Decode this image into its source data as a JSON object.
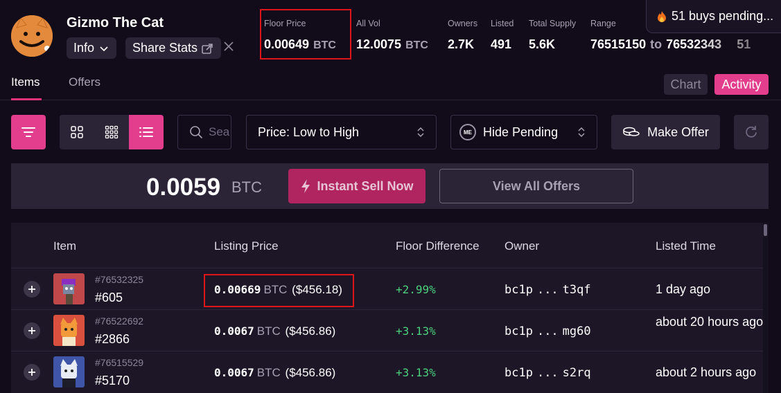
{
  "collection": {
    "name": "Gizmo The Cat",
    "info_label": "Info",
    "share_label": "Share Stats"
  },
  "stats": {
    "floor_label": "Floor Price",
    "floor_value": "0.00649",
    "floor_unit": "BTC",
    "vol_label": "All Vol",
    "vol_value": "12.0075",
    "vol_unit": "BTC",
    "owners_label": "Owners",
    "owners_value": "2.7K",
    "listed_label": "Listed",
    "listed_value": "491",
    "supply_label": "Total Supply",
    "supply_value": "5.6K",
    "range_label": "Range",
    "range_from": "76515150",
    "range_to_word": "to",
    "range_to": "76532343",
    "range_extra": "51"
  },
  "pending": {
    "text": "51 buys pending..."
  },
  "tabs": {
    "items": "Items",
    "offers": "Offers"
  },
  "view_toggle": {
    "chart": "Chart",
    "activity": "Activity"
  },
  "toolbar": {
    "search_placeholder": "Search",
    "sort_value": "Price: Low to High",
    "pending_value": "Hide Pending",
    "me_logo": "ME",
    "make_offer": "Make Offer"
  },
  "sell_banner": {
    "amount": "0.0059",
    "unit": "BTC",
    "instant_sell": "Instant Sell Now",
    "view_offers": "View All Offers"
  },
  "table": {
    "headers": {
      "item": "Item",
      "price": "Listing Price",
      "floor_diff": "Floor Difference",
      "owner": "Owner",
      "listed": "Listed Time"
    },
    "rows": [
      {
        "inscription": "#76532325",
        "name": "#605",
        "price": "0.00669",
        "unit": "BTC",
        "usd": "($456.18)",
        "floor_diff": "+2.99%",
        "owner_start": "bc1p",
        "owner_dots": "...",
        "owner_end": "t3qf",
        "listed": "1 day ago",
        "thumb_color": "#c0484a"
      },
      {
        "inscription": "#76522692",
        "name": "#2866",
        "price": "0.0067",
        "unit": "BTC",
        "usd": "($456.86)",
        "floor_diff": "+3.13%",
        "owner_start": "bc1p",
        "owner_dots": "...",
        "owner_end": "mg60",
        "listed": "about 20 hours ago",
        "thumb_color": "#d9503e"
      },
      {
        "inscription": "#76515529",
        "name": "#5170",
        "price": "0.0067",
        "unit": "BTC",
        "usd": "($456.86)",
        "floor_diff": "+3.13%",
        "owner_start": "bc1p",
        "owner_dots": "...",
        "owner_end": "s2rq",
        "listed": "about 2 hours ago",
        "thumb_color": "#3f56a8"
      }
    ]
  },
  "colors": {
    "accent": "#e23e8d",
    "positive": "#4cd07d",
    "highlight_box": "#e0151a"
  }
}
